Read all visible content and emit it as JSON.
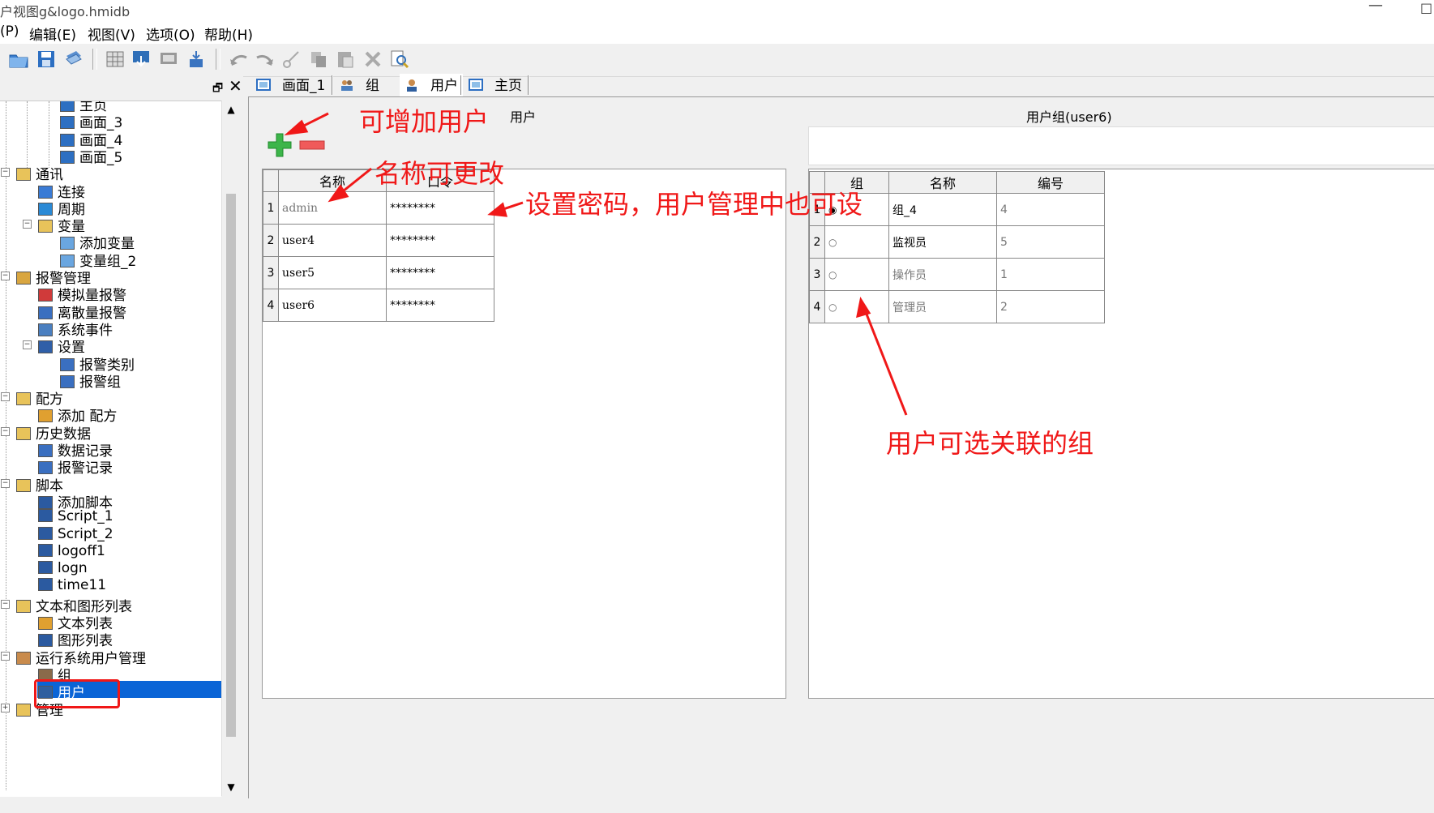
{
  "window": {
    "title": "户视图g&logo.hmidb",
    "minimize": "—",
    "restore": "□"
  },
  "menu": [
    "(P)",
    "编辑(E)",
    "视图(V)",
    "选项(O)",
    "帮助(H)"
  ],
  "left_panel": {
    "restore_glyph": "🗗",
    "close_glyph": "✕"
  },
  "tree": [
    {
      "label": "主页",
      "icon": "screen-icon"
    },
    {
      "label": "画面_3",
      "icon": "screen-icon"
    },
    {
      "label": "画面_4",
      "icon": "screen-icon"
    },
    {
      "label": "画面_5",
      "icon": "screen-icon"
    },
    {
      "label": "通讯",
      "icon": "folder-icon"
    },
    {
      "label": "连接",
      "icon": "connection-icon"
    },
    {
      "label": "周期",
      "icon": "cycle-icon"
    },
    {
      "label": "变量",
      "icon": "folder-icon"
    },
    {
      "label": "添加变量",
      "icon": "tag-icon"
    },
    {
      "label": "变量组_2",
      "icon": "tag-icon"
    },
    {
      "label": "报警管理",
      "icon": "alarm-folder-icon"
    },
    {
      "label": "模拟量报警",
      "icon": "analog-alarm-icon"
    },
    {
      "label": "离散量报警",
      "icon": "discrete-alarm-icon"
    },
    {
      "label": "系统事件",
      "icon": "event-icon"
    },
    {
      "label": "设置",
      "icon": "settings-icon"
    },
    {
      "label": "报警类别",
      "icon": "alarm-class-icon"
    },
    {
      "label": "报警组",
      "icon": "alarm-group-icon"
    },
    {
      "label": "配方",
      "icon": "folder-icon"
    },
    {
      "label": "添加 配方",
      "icon": "recipe-icon"
    },
    {
      "label": "历史数据",
      "icon": "folder-icon"
    },
    {
      "label": "数据记录",
      "icon": "data-log-icon"
    },
    {
      "label": "报警记录",
      "icon": "alarm-log-icon"
    },
    {
      "label": "脚本",
      "icon": "folder-icon"
    },
    {
      "label": "添加脚本",
      "icon": "script-icon"
    },
    {
      "label": "Script_1",
      "icon": "script-icon"
    },
    {
      "label": "Script_2",
      "icon": "script-icon"
    },
    {
      "label": "logoff1",
      "icon": "script-icon"
    },
    {
      "label": "logn",
      "icon": "script-icon"
    },
    {
      "label": "time11",
      "icon": "script-icon"
    },
    {
      "label": "文本和图形列表",
      "icon": "folder-icon"
    },
    {
      "label": "文本列表",
      "icon": "text-list-icon"
    },
    {
      "label": "图形列表",
      "icon": "graphic-list-icon"
    },
    {
      "label": "运行系统用户管理",
      "icon": "user-admin-icon"
    },
    {
      "label": "组",
      "icon": "group-icon"
    },
    {
      "label": "用户",
      "icon": "user-icon"
    },
    {
      "label": "管理",
      "icon": "folder-icon"
    }
  ],
  "tabs": [
    "画面_1",
    "组",
    "用户",
    "主页"
  ],
  "users_section": {
    "title": "用户",
    "columns": [
      "名称",
      "口令"
    ],
    "rows": [
      {
        "num": "1",
        "name": "admin",
        "password": "********"
      },
      {
        "num": "2",
        "name": "user4",
        "password": "********"
      },
      {
        "num": "3",
        "name": "user5",
        "password": "********"
      },
      {
        "num": "4",
        "name": "user6",
        "password": "********"
      }
    ]
  },
  "groups_section": {
    "title": "用户组(user6)",
    "columns": [
      "组",
      "名称",
      "编号"
    ],
    "rows": [
      {
        "num": "1",
        "name": "组_4",
        "id": "4",
        "selected": true
      },
      {
        "num": "2",
        "name": "监视员",
        "id": "5",
        "selected": false
      },
      {
        "num": "3",
        "name": "操作员",
        "id": "1",
        "selected": false
      },
      {
        "num": "4",
        "name": "管理员",
        "id": "2",
        "selected": false
      }
    ]
  },
  "annotations": {
    "add_user": "可增加用户",
    "rename": "名称可更改",
    "password": "设置密码，用户管理中也可设",
    "groups": "用户可选关联的组",
    "color": "#f01818"
  }
}
